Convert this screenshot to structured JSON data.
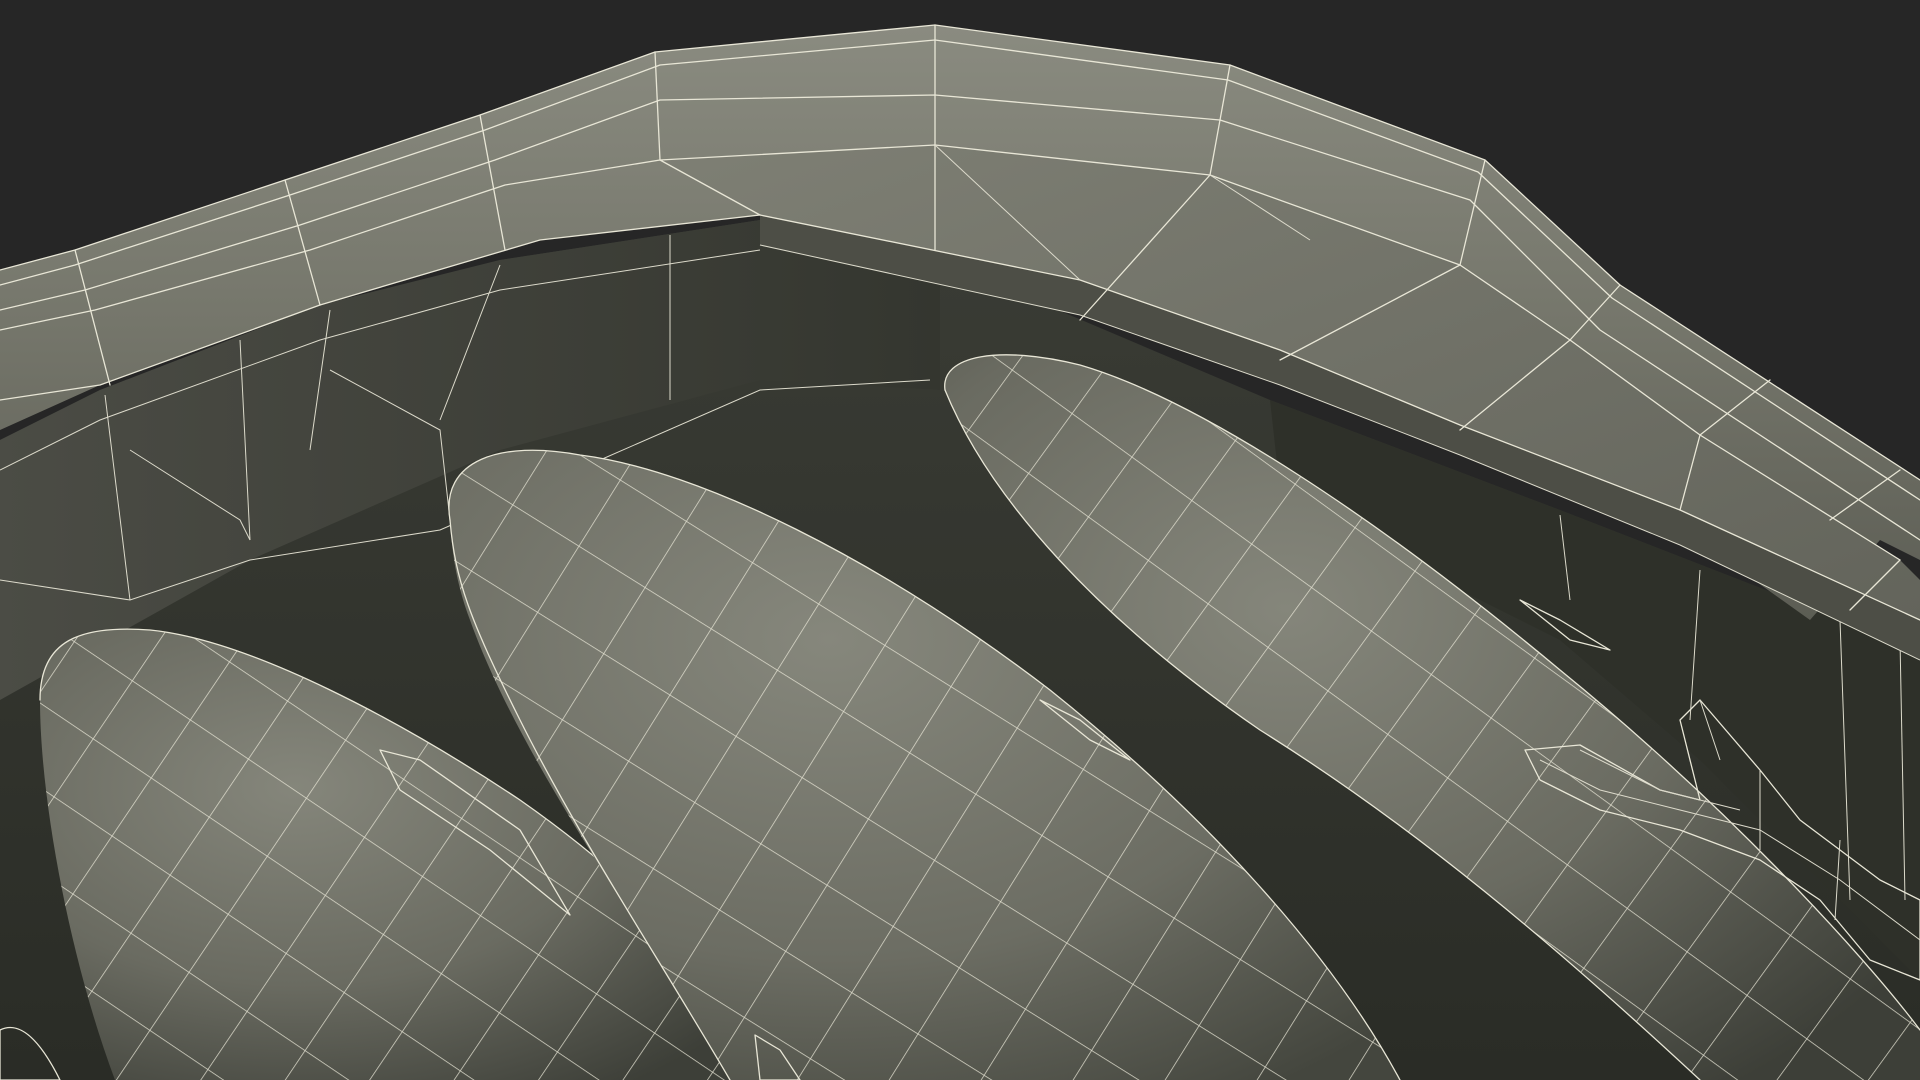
{
  "scene": {
    "subject": "wireframe-render",
    "colors": {
      "background": "#262626",
      "surface_light": "#7b7c71",
      "surface_mid": "#5f6057",
      "surface_dark": "#33352f",
      "interior_shadow": "#25271f",
      "wire": "#e8e6d6"
    }
  }
}
